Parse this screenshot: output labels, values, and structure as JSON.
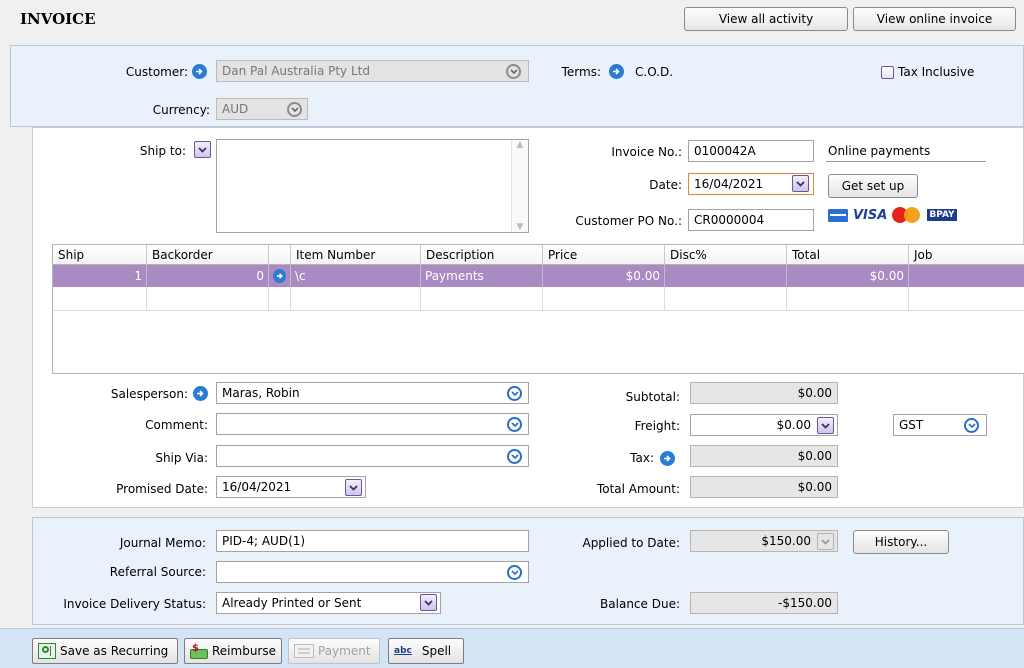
{
  "window": {
    "title": "INVOICE"
  },
  "header": {
    "view_all_activity": "View all activity",
    "view_online_invoice": "View online invoice"
  },
  "top": {
    "customer_label": "Customer:",
    "customer_value": "Dan Pal Australia Pty Ltd",
    "terms_label": "Terms:",
    "terms_value": "C.O.D.",
    "tax_inclusive_label": "Tax Inclusive",
    "currency_label": "Currency:",
    "currency_value": "AUD"
  },
  "invoice": {
    "ship_to_label": "Ship to:",
    "invoice_no_label": "Invoice No.:",
    "invoice_no_value": "0100042A",
    "date_label": "Date:",
    "date_value": "16/04/2021",
    "customer_po_label": "Customer PO No.:",
    "customer_po_value": "CR0000004",
    "online_payments_label": "Online payments",
    "get_set_up_label": "Get set up",
    "payment_logos": {
      "visa": "VISA",
      "bpay": "BPAY"
    }
  },
  "grid": {
    "columns": [
      "Ship",
      "Backorder",
      "",
      "Item Number",
      "Description",
      "Price",
      "Disc%",
      "Total",
      "Job"
    ],
    "rows": [
      {
        "ship": "1",
        "backorder": "0",
        "item_number": "\\c",
        "description": "Payments",
        "price": "$0.00",
        "disc": "",
        "total": "$0.00",
        "job": ""
      }
    ]
  },
  "details": {
    "salesperson_label": "Salesperson:",
    "salesperson_value": "Maras, Robin",
    "comment_label": "Comment:",
    "ship_via_label": "Ship Via:",
    "promised_date_label": "Promised Date:",
    "promised_date_value": "16/04/2021",
    "subtotal_label": "Subtotal:",
    "subtotal_value": "$0.00",
    "freight_label": "Freight:",
    "freight_value": "$0.00",
    "freight_tax_code": "GST",
    "tax_label": "Tax:",
    "tax_value": "$0.00",
    "total_amount_label": "Total Amount:",
    "total_amount_value": "$0.00"
  },
  "footer": {
    "journal_memo_label": "Journal Memo:",
    "journal_memo_value": "PID-4; AUD(1)",
    "referral_source_label": "Referral Source:",
    "delivery_status_label": "Invoice Delivery Status:",
    "delivery_status_value": "Already Printed or Sent",
    "applied_to_date_label": "Applied to Date:",
    "applied_to_date_value": "$150.00",
    "history_label": "History...",
    "balance_due_label": "Balance Due:",
    "balance_due_value": "-$150.00"
  },
  "toolbar": {
    "save_as_recurring": "Save as Recurring",
    "reimburse": "Reimburse",
    "payment": "Payment",
    "spell": "Spell",
    "spell_icon_text": "abc"
  }
}
